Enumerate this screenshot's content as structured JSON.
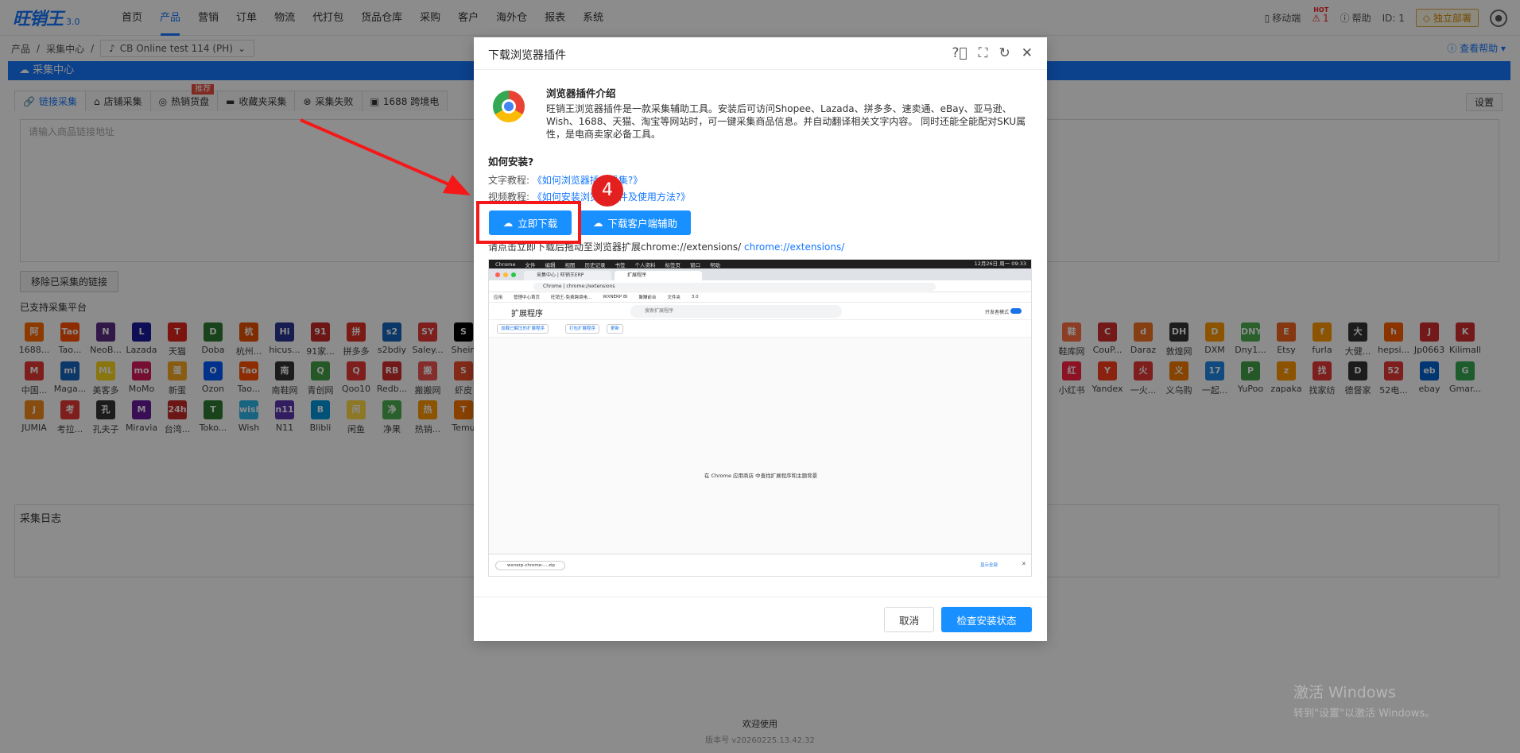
{
  "brand": {
    "logo_text": "旺销王",
    "version": "3.0"
  },
  "nav": {
    "items": [
      "首页",
      "产品",
      "营销",
      "订单",
      "物流",
      "代打包",
      "货品仓库",
      "采购",
      "客户",
      "海外仓",
      "报表",
      "系统"
    ],
    "active": "产品"
  },
  "topright": {
    "mobile": "移动端",
    "hot": "HOT",
    "alerts": "1",
    "help": "帮助",
    "id": "ID: 1",
    "deploy": "独立部署"
  },
  "breadcrumb": {
    "a": "产品",
    "b": "采集中心",
    "store": "CB Online test 114 (PH)"
  },
  "view_help": "查看帮助",
  "bluebar": "采集中心",
  "tabs": [
    {
      "label": "链接采集"
    },
    {
      "label": "店铺采集"
    },
    {
      "label": "热销货盘"
    },
    {
      "label": "收藏夹采集"
    },
    {
      "label": "采集失败"
    },
    {
      "label": "1688 跨境电"
    }
  ],
  "tab_badge": "推荐",
  "settings": "设置",
  "url_placeholder": "请输入商品链接地址",
  "remove_button": "移除已采集的链接",
  "platforms_label": "已支持采集平台",
  "platforms": {
    "left": [
      {
        "name": "1688...",
        "icon": "阿",
        "color": "#ff6a00"
      },
      {
        "name": "Tao...",
        "icon": "Tao",
        "color": "#ff5000"
      },
      {
        "name": "NeoB...",
        "icon": "N",
        "color": "#5b2c83"
      },
      {
        "name": "Lazada",
        "icon": "L",
        "color": "#1a1a9e"
      },
      {
        "name": "天猫",
        "icon": "T",
        "color": "#e1251b"
      },
      {
        "name": "Doba",
        "icon": "D",
        "color": "#2e7d32"
      },
      {
        "name": "杭州...",
        "icon": "杭",
        "color": "#e65100"
      },
      {
        "name": "hicus...",
        "icon": "Hi",
        "color": "#283593"
      },
      {
        "name": "91家...",
        "icon": "91",
        "color": "#c62828"
      },
      {
        "name": "拼多多",
        "icon": "拼",
        "color": "#e02e24"
      },
      {
        "name": "s2bdiy",
        "icon": "s2",
        "color": "#1565c0"
      },
      {
        "name": "Saley...",
        "icon": "SY",
        "color": "#e53935"
      },
      {
        "name": "Shein",
        "icon": "S",
        "color": "#000000"
      },
      {
        "name": "中国...",
        "icon": "M",
        "color": "#e53935"
      },
      {
        "name": "Maga...",
        "icon": "mi",
        "color": "#1565c0"
      },
      {
        "name": "美客多",
        "icon": "ML",
        "color": "#f9d71c"
      },
      {
        "name": "MoMo",
        "icon": "mo",
        "color": "#d81b60"
      },
      {
        "name": "新蛋",
        "icon": "蛋",
        "color": "#f9a825"
      },
      {
        "name": "Ozon",
        "icon": "O",
        "color": "#005bff"
      },
      {
        "name": "Tao...",
        "icon": "Tao",
        "color": "#ff5000"
      },
      {
        "name": "南鞋网",
        "icon": "南",
        "color": "#333333"
      },
      {
        "name": "青创网",
        "icon": "Q",
        "color": "#43a047"
      },
      {
        "name": "Qoo10",
        "icon": "Q",
        "color": "#e53935"
      },
      {
        "name": "Redb...",
        "icon": "RB",
        "color": "#d32f2f"
      },
      {
        "name": "搬搬网",
        "icon": "搬",
        "color": "#ef5350"
      },
      {
        "name": "虾皮",
        "icon": "S",
        "color": "#ee4d2d"
      },
      {
        "name": "JUMIA",
        "icon": "J",
        "color": "#f68b1e"
      },
      {
        "name": "考拉...",
        "icon": "考",
        "color": "#e53935"
      },
      {
        "name": "孔夫子",
        "icon": "孔",
        "color": "#333333"
      },
      {
        "name": "Miravia",
        "icon": "M",
        "color": "#6a1b9a"
      },
      {
        "name": "台湾...",
        "icon": "24h",
        "color": "#c62828"
      },
      {
        "name": "Toko...",
        "icon": "T",
        "color": "#2e7d32"
      },
      {
        "name": "Wish",
        "icon": "wish",
        "color": "#2fb7ec"
      },
      {
        "name": "N11",
        "icon": "n11",
        "color": "#5e35b1"
      },
      {
        "name": "Blibli",
        "icon": "B",
        "color": "#0095da"
      },
      {
        "name": "闲鱼",
        "icon": "闲",
        "color": "#ffda44"
      },
      {
        "name": "净果",
        "icon": "净",
        "color": "#4caf50"
      },
      {
        "name": "热销...",
        "icon": "热",
        "color": "#ff9800"
      },
      {
        "name": "Temu",
        "icon": "T",
        "color": "#fb7701"
      }
    ],
    "right": [
      {
        "name": "鞋库网",
        "icon": "鞋",
        "color": "#ff7043"
      },
      {
        "name": "CouP...",
        "icon": "C",
        "color": "#d32f2f"
      },
      {
        "name": "Daraz",
        "icon": "d",
        "color": "#f57224"
      },
      {
        "name": "敦煌网",
        "icon": "DH",
        "color": "#333333"
      },
      {
        "name": "DXM",
        "icon": "D",
        "color": "#ff9800"
      },
      {
        "name": "Dny1...",
        "icon": "DNY",
        "color": "#4caf50"
      },
      {
        "name": "Etsy",
        "icon": "E",
        "color": "#f1641e"
      },
      {
        "name": "furla",
        "icon": "f",
        "color": "#ff9800"
      },
      {
        "name": "大健...",
        "icon": "大",
        "color": "#333333"
      },
      {
        "name": "hepsi...",
        "icon": "h",
        "color": "#ff6000"
      },
      {
        "name": "Jp0663",
        "icon": "J",
        "color": "#d32f2f"
      },
      {
        "name": "Kilimall",
        "icon": "K",
        "color": "#d32f2f"
      },
      {
        "name": "小红书",
        "icon": "红",
        "color": "#ff2442"
      },
      {
        "name": "Yandex",
        "icon": "Y",
        "color": "#fc3f1d"
      },
      {
        "name": "一火...",
        "icon": "火",
        "color": "#e53935"
      },
      {
        "name": "义乌购",
        "icon": "义",
        "color": "#f57c00"
      },
      {
        "name": "一起...",
        "icon": "17",
        "color": "#1e88e5"
      },
      {
        "name": "YuPoo",
        "icon": "P",
        "color": "#43a047"
      },
      {
        "name": "zapaka",
        "icon": "z",
        "color": "#ff9800"
      },
      {
        "name": "找家纺",
        "icon": "找",
        "color": "#e53935"
      },
      {
        "name": "德督家",
        "icon": "D",
        "color": "#333333"
      },
      {
        "name": "52电...",
        "icon": "52",
        "color": "#e53935"
      },
      {
        "name": "ebay",
        "icon": "eb",
        "color": "#0064d2"
      },
      {
        "name": "Gmar...",
        "icon": "G",
        "color": "#34a853"
      }
    ]
  },
  "log_title": "采集日志",
  "footer": {
    "welcome": "欢迎使用",
    "version": "版本号 v20260225.13.42.32"
  },
  "windows": {
    "line1": "激活 Windows",
    "line2": "转到\"设置\"以激活 Windows。"
  },
  "modal": {
    "title": "下载浏览器插件",
    "intro_title": "浏览器插件介绍",
    "intro_text": "旺销王浏览器插件是一款采集辅助工具。安装后可访问Shopee、Lazada、拼多多、速卖通、eBay、亚马逊、Wish、1688、天猫、淘宝等网站时，可一键采集商品信息。并自动翻译相关文字内容。 同时还能全能配对SKU属性，是电商卖家必备工具。",
    "how_title": "如何安装?",
    "text_tut_label": "文字教程:",
    "text_tut_link": "《如何浏览器插件采集?》",
    "video_tut_label": "视频教程:",
    "video_tut_link": "《如何安装浏览器插件及使用方法?》",
    "download_btn": "立即下载",
    "client_btn": "下载客户端辅助",
    "ext_instruction": "请点击立即下载后拖动至浏览器扩展chrome://extensions/",
    "ext_link": "chrome://extensions/",
    "step": "4",
    "cancel": "取消",
    "check": "检查安装状态"
  },
  "screenshot": {
    "menubar": [
      "Chrome",
      "文件",
      "编辑",
      "视图",
      "历史记录",
      "书签",
      "个人资料",
      "标签页",
      "窗口",
      "帮助"
    ],
    "clock": "12月26日 周一 09:33",
    "tab1": "采集中心 | 旺销王ERP",
    "tab2": "扩展程序",
    "address": "Chrome | chrome://extensions",
    "bookmarks": [
      "应用",
      "管理中心首页",
      "旺销王-免费跨境电...",
      "WXNERP BI",
      "聚赚前台",
      "文件夹",
      "3.0"
    ],
    "ext_title": "扩展程序",
    "search_placeholder": "搜索扩展程序",
    "dev_mode": "开发者模式",
    "buttons": [
      "加载已解压的扩展程序",
      "打包扩展程序",
      "更新"
    ],
    "center_text": "在 Chrome 应用商店 中查找扩展程序和主题背景",
    "download_file": "wxnerp-chrome-....zip",
    "show_all": "显示全部"
  }
}
